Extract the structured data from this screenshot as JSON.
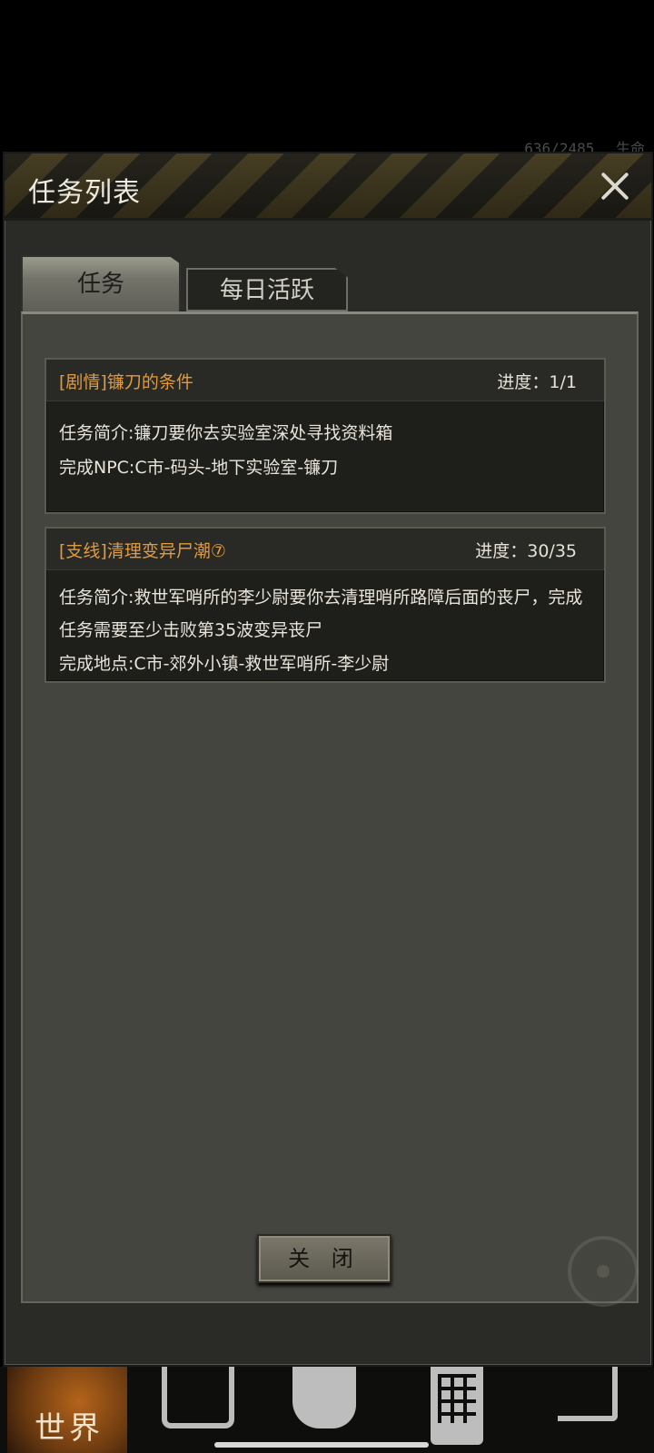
{
  "background": {
    "status_left": "636/2485",
    "status_right": "生命"
  },
  "dialog": {
    "title": "任务列表",
    "tabs": [
      {
        "label": "任务",
        "active": true
      },
      {
        "label": "每日活跃",
        "active": false
      }
    ],
    "quests": [
      {
        "title": "[剧情]镰刀的条件",
        "progress": "进度：1/1",
        "lines": [
          "任务简介:镰刀要你去实验室深处寻找资料箱",
          "完成NPC:C市-码头-地下实验室-镰刀"
        ]
      },
      {
        "title": "[支线]清理变异尸潮⑦",
        "progress": "进度：30/35",
        "lines": [
          "任务简介:救世军哨所的李少尉要你去清理哨所路障后面的丧尸，完成任务需要至少击败第35波变异丧尸",
          "完成地点:C市-郊外小镇-救世军哨所-李少尉"
        ]
      }
    ],
    "close_button_label": "关 闭"
  },
  "bottom_nav": {
    "items": [
      {
        "label": "世界",
        "icon": "globe-icon"
      },
      {
        "label": "",
        "icon": "backpack-icon"
      },
      {
        "label": "",
        "icon": "head-icon"
      },
      {
        "label": "",
        "icon": "phone-icon"
      },
      {
        "label": "",
        "icon": "cart-icon"
      }
    ]
  }
}
